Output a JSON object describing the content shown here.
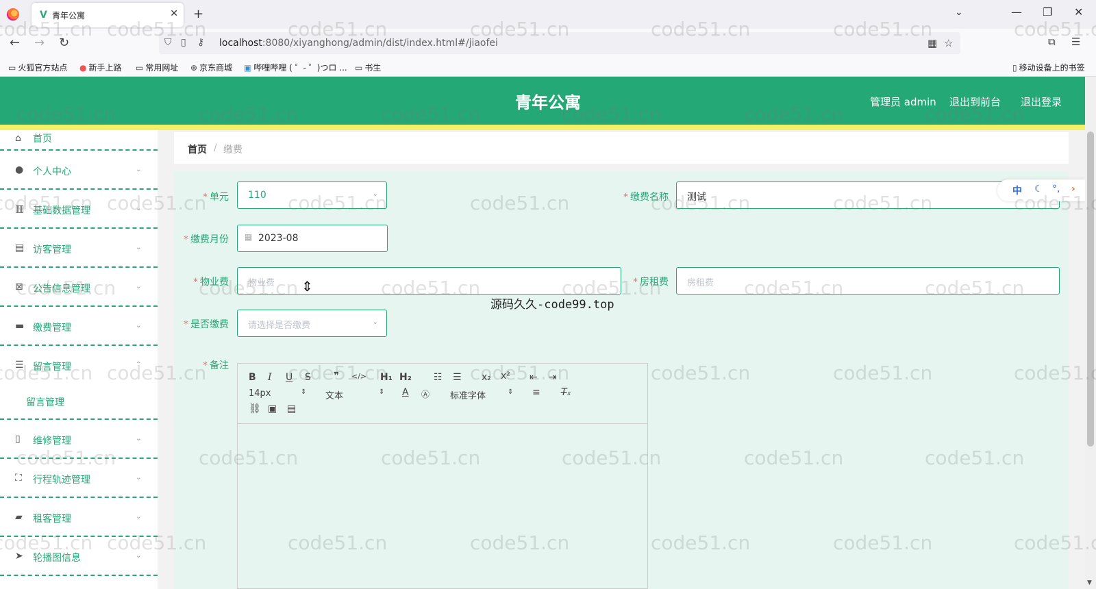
{
  "browser": {
    "tab_title": "青年公寓",
    "tab_favicon": "V",
    "url_host": "localhost",
    "url_rest": ":8080/xiyanghong/admin/dist/index.html#/jiaofei",
    "bookmarks": [
      "火狐官方站点",
      "新手上路",
      "常用网址",
      "京东商城",
      "哔哩哔哩 ( ゜- ゜)つロ ...",
      "书生"
    ],
    "mobile_bookmarks": "移动设备上的书签"
  },
  "header": {
    "title": "青年公寓",
    "admin_label": "管理员 admin",
    "back_front": "退出到前台",
    "logout": "退出登录"
  },
  "sidebar": {
    "items": [
      {
        "label": "首页",
        "icon": "home-icon"
      },
      {
        "label": "个人中心",
        "icon": "user-icon"
      },
      {
        "label": "基础数据管理",
        "icon": "chart-icon"
      },
      {
        "label": "访客管理",
        "icon": "clipboard-icon"
      },
      {
        "label": "公告信息管理",
        "icon": "notice-icon"
      },
      {
        "label": "缴费管理",
        "icon": "briefcase-icon"
      },
      {
        "label": "留言管理",
        "icon": "message-icon"
      },
      {
        "label": "维修管理",
        "icon": "repair-icon"
      },
      {
        "label": "行程轨迹管理",
        "icon": "track-icon"
      },
      {
        "label": "租客管理",
        "icon": "ticket-icon"
      },
      {
        "label": "轮播图信息",
        "icon": "send-icon"
      }
    ],
    "sub_item": "留言管理"
  },
  "breadcrumb": {
    "home": "首页",
    "sep": "/",
    "current": "缴费"
  },
  "form": {
    "unit_label": "单元",
    "unit_value": "110",
    "fee_name_label": "缴费名称",
    "fee_name_value": "测试",
    "month_label": "缴费月份",
    "month_value": "2023-08",
    "property_label": "物业费",
    "property_placeholder": "物业费",
    "rent_label": "房租费",
    "rent_placeholder": "房租费",
    "paid_label": "是否缴费",
    "paid_placeholder": "请选择是否缴费",
    "note_label": "备注",
    "required_mark": "*"
  },
  "editor": {
    "font_size": "14px",
    "text_type": "文本",
    "font_family": "标准字体"
  },
  "lang_switch": {
    "zh": "中"
  },
  "overlay_text": "源码久久-code99.top",
  "watermark": "code51.cn",
  "colors": {
    "primary": "#24a876",
    "accent_bar": "#f4f169",
    "required": "#f56c6c",
    "form_bg": "#e6f5ef"
  }
}
